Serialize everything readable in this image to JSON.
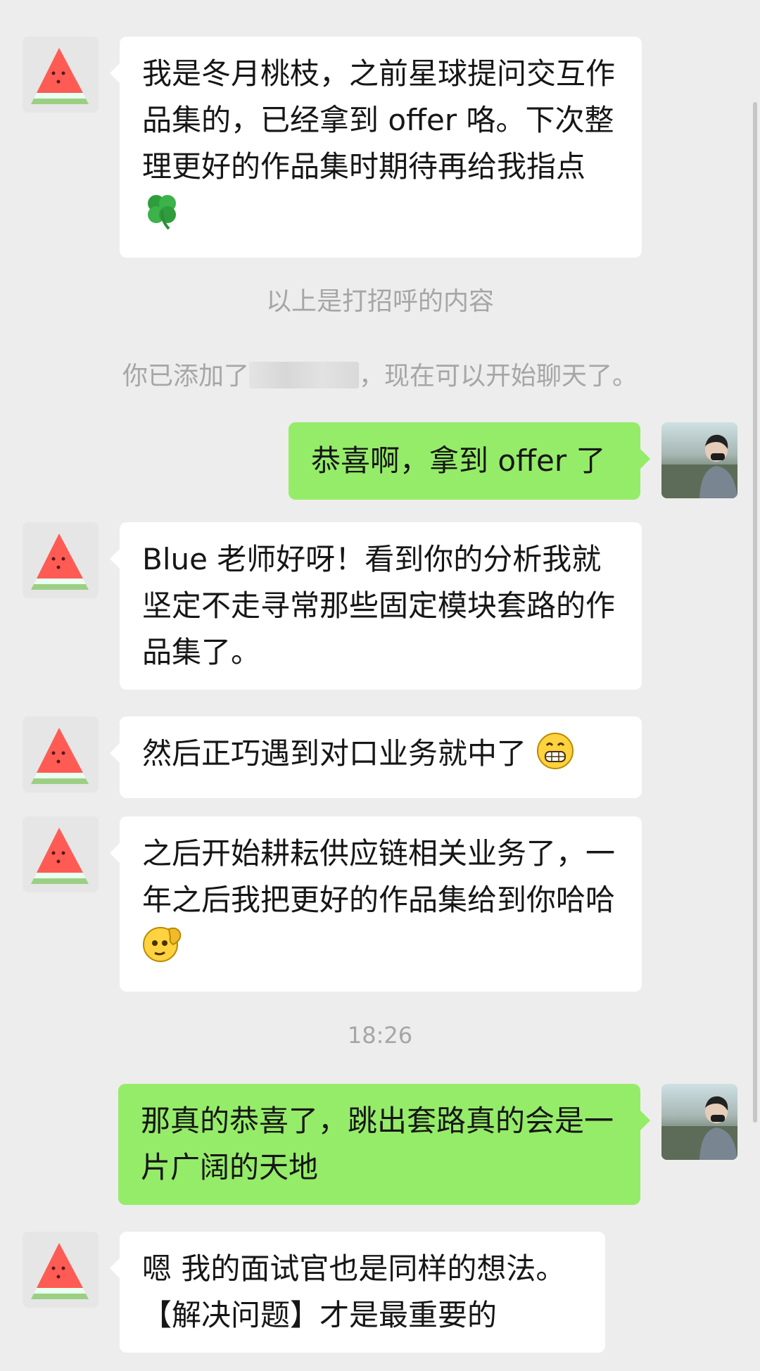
{
  "chat": {
    "messages": [
      {
        "sender": "contact",
        "text": "我是冬月桃枝，之前星球提问交互作品集的，已经拿到 offer 咯。下次整理更好的作品集时期待再给我指点",
        "emoji": "four-leaf-clover"
      },
      {
        "type": "system",
        "text": "以上是打招呼的内容"
      },
      {
        "type": "system",
        "prefix": "你已添加了",
        "suffix": "，现在可以开始聊天了。"
      },
      {
        "sender": "me",
        "text": "恭喜啊，拿到 offer 了"
      },
      {
        "sender": "contact",
        "text": "Blue 老师好呀！看到你的分析我就坚定不走寻常那些固定模块套路的作品集了。"
      },
      {
        "sender": "contact",
        "text": "然后正巧遇到对口业务就中了 ",
        "emoji": "grinning-face"
      },
      {
        "sender": "contact",
        "text": "之后开始耕耘供应链相关业务了，一年之后我把更好的作品集给到你哈哈",
        "emoji": "saluting-face"
      },
      {
        "type": "timestamp",
        "text": "18:26"
      },
      {
        "sender": "me",
        "text": "那真的恭喜了，跳出套路真的会是一片广阔的天地"
      },
      {
        "sender": "contact",
        "text": "嗯 我的面试官也是同样的想法。【解决问题】才是最重要的"
      }
    ]
  },
  "colors": {
    "background": "#ededed",
    "incoming_bubble": "#ffffff",
    "outgoing_bubble": "#95ec69",
    "system_text": "#a6a6a6",
    "message_text": "#161616"
  },
  "icons": {
    "contact_avatar": "watermelon-slice-avatar",
    "my_avatar": "person-photo-avatar"
  }
}
